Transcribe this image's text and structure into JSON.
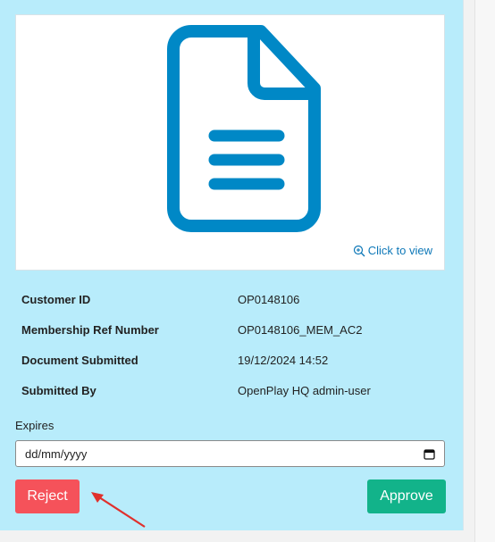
{
  "document_preview": {
    "icon": "document-icon",
    "click_to_view": "Click to view",
    "accent_color": "#0088c6"
  },
  "details": [
    {
      "label": "Customer ID",
      "value": "OP0148106"
    },
    {
      "label": "Membership Ref Number",
      "value": "OP0148106_MEM_AC2"
    },
    {
      "label": "Document Submitted",
      "value": "19/12/2024 14:52"
    },
    {
      "label": "Submitted By",
      "value": "OpenPlay HQ admin-user"
    }
  ],
  "expires": {
    "label": "Expires",
    "placeholder": "dd/mm/yyyy"
  },
  "actions": {
    "reject_label": "Reject",
    "approve_label": "Approve",
    "reject_color": "#f5525a",
    "approve_color": "#12b38a"
  },
  "annotation": {
    "arrow_color": "#e0302c"
  }
}
